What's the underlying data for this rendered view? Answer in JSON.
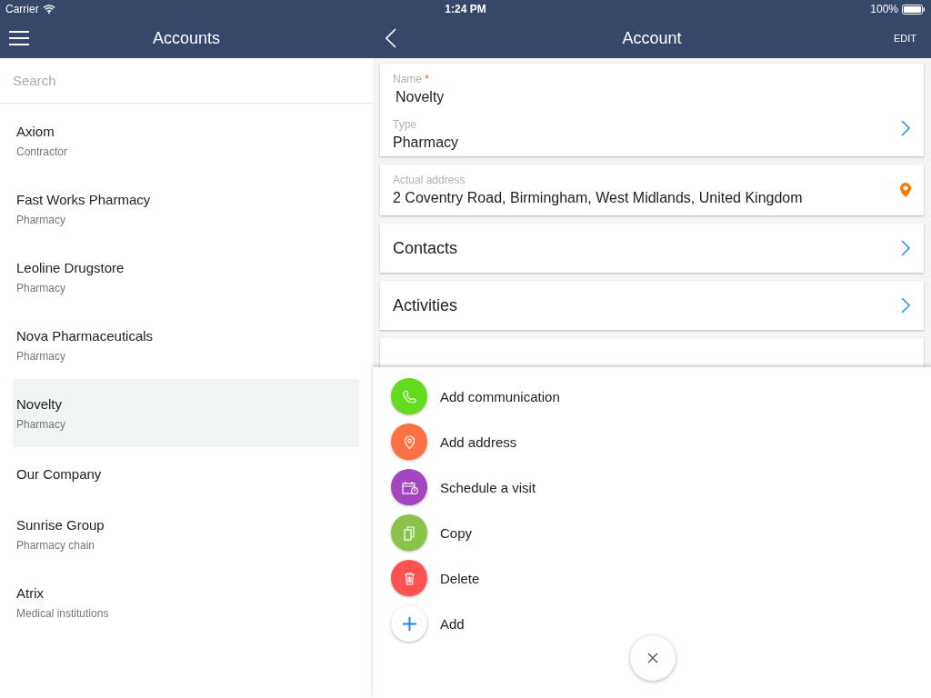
{
  "status_bar": {
    "carrier": "Carrier",
    "time": "1:24 PM",
    "battery": "100%"
  },
  "left_nav": {
    "title": "Accounts"
  },
  "right_nav": {
    "title": "Account",
    "action": "EDIT"
  },
  "search": {
    "placeholder": "Search"
  },
  "accounts": [
    {
      "name": "Axiom",
      "type": "Contractor",
      "selected": false
    },
    {
      "name": "Fast Works Pharmacy",
      "type": "Pharmacy",
      "selected": false
    },
    {
      "name": "Leoline Drugstore",
      "type": "Pharmacy",
      "selected": false
    },
    {
      "name": "Nova Pharmaceuticals",
      "type": "Pharmacy",
      "selected": false
    },
    {
      "name": "Novelty",
      "type": "Pharmacy",
      "selected": true
    },
    {
      "name": "Our Company",
      "selected": false
    },
    {
      "name": "Sunrise Group",
      "type": "Pharmacy chain",
      "selected": false
    },
    {
      "name": "Atrix",
      "type": "Medical institutions",
      "selected": false
    }
  ],
  "details": {
    "name_field": {
      "label": "Name",
      "required_mark": "*",
      "value": "Novelty"
    },
    "type_field": {
      "label": "Type",
      "value": "Pharmacy"
    },
    "address_field": {
      "label": "Actual address",
      "value": "2 Coventry Road, Birmingham, West Midlands, United Kingdom"
    },
    "sections": [
      "Contacts",
      "Activities"
    ]
  },
  "actions": [
    {
      "kind": "phone",
      "label": "Add communication",
      "color": "#64dc1e"
    },
    {
      "kind": "pin",
      "label": "Add address",
      "color": "#ff7043"
    },
    {
      "kind": "calendar",
      "label": "Schedule a visit",
      "color": "#a347c0"
    },
    {
      "kind": "copy",
      "label": "Copy",
      "color": "#8bc34a"
    },
    {
      "kind": "trash",
      "label": "Delete",
      "color": "#ff5252"
    },
    {
      "kind": "plus",
      "label": "Add",
      "color": "#ffffff"
    }
  ]
}
